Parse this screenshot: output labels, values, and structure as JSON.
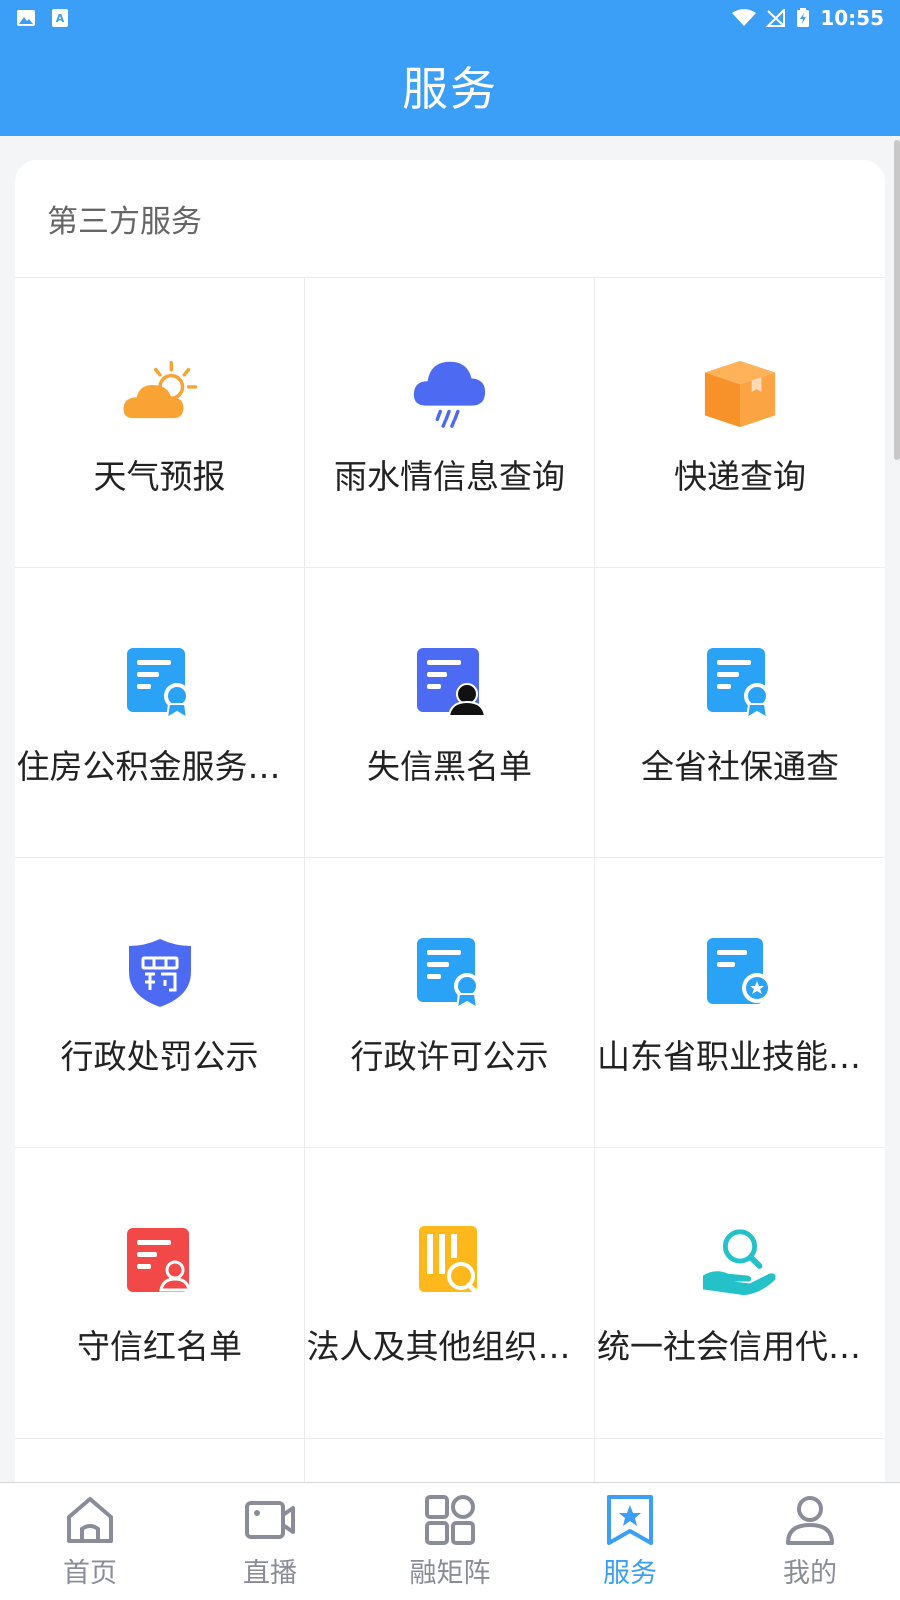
{
  "status_bar": {
    "time": "10:55"
  },
  "header": {
    "title": "服务"
  },
  "section": {
    "title": "第三方服务",
    "items": [
      {
        "label": "天气预报",
        "icon": "weather-icon"
      },
      {
        "label": "雨水情信息查询",
        "icon": "rain-cloud-icon"
      },
      {
        "label": "快递查询",
        "icon": "package-icon"
      },
      {
        "label": "住房公积金服务大厅",
        "icon": "certificate-icon"
      },
      {
        "label": "失信黑名单",
        "icon": "blacklist-icon"
      },
      {
        "label": "全省社保通查",
        "icon": "certificate-icon"
      },
      {
        "label": "行政处罚公示",
        "icon": "penalty-shield-icon"
      },
      {
        "label": "行政许可公示",
        "icon": "certificate-icon"
      },
      {
        "label": "山东省职业技能证书查询",
        "icon": "skill-certificate-icon"
      },
      {
        "label": "守信红名单",
        "icon": "redlist-icon"
      },
      {
        "label": "法人及其他组织信用信息",
        "icon": "document-search-icon"
      },
      {
        "label": "统一社会信用代码查询",
        "icon": "hand-search-icon"
      }
    ]
  },
  "tabs": [
    {
      "label": "首页",
      "icon": "home-icon",
      "active": false
    },
    {
      "label": "直播",
      "icon": "video-icon",
      "active": false
    },
    {
      "label": "融矩阵",
      "icon": "grid-icon",
      "active": false
    },
    {
      "label": "服务",
      "icon": "bookmark-star-icon",
      "active": true
    },
    {
      "label": "我的",
      "icon": "user-icon",
      "active": false
    }
  ],
  "colors": {
    "primary": "#3b9ff7",
    "inactive": "#8a8d99"
  }
}
